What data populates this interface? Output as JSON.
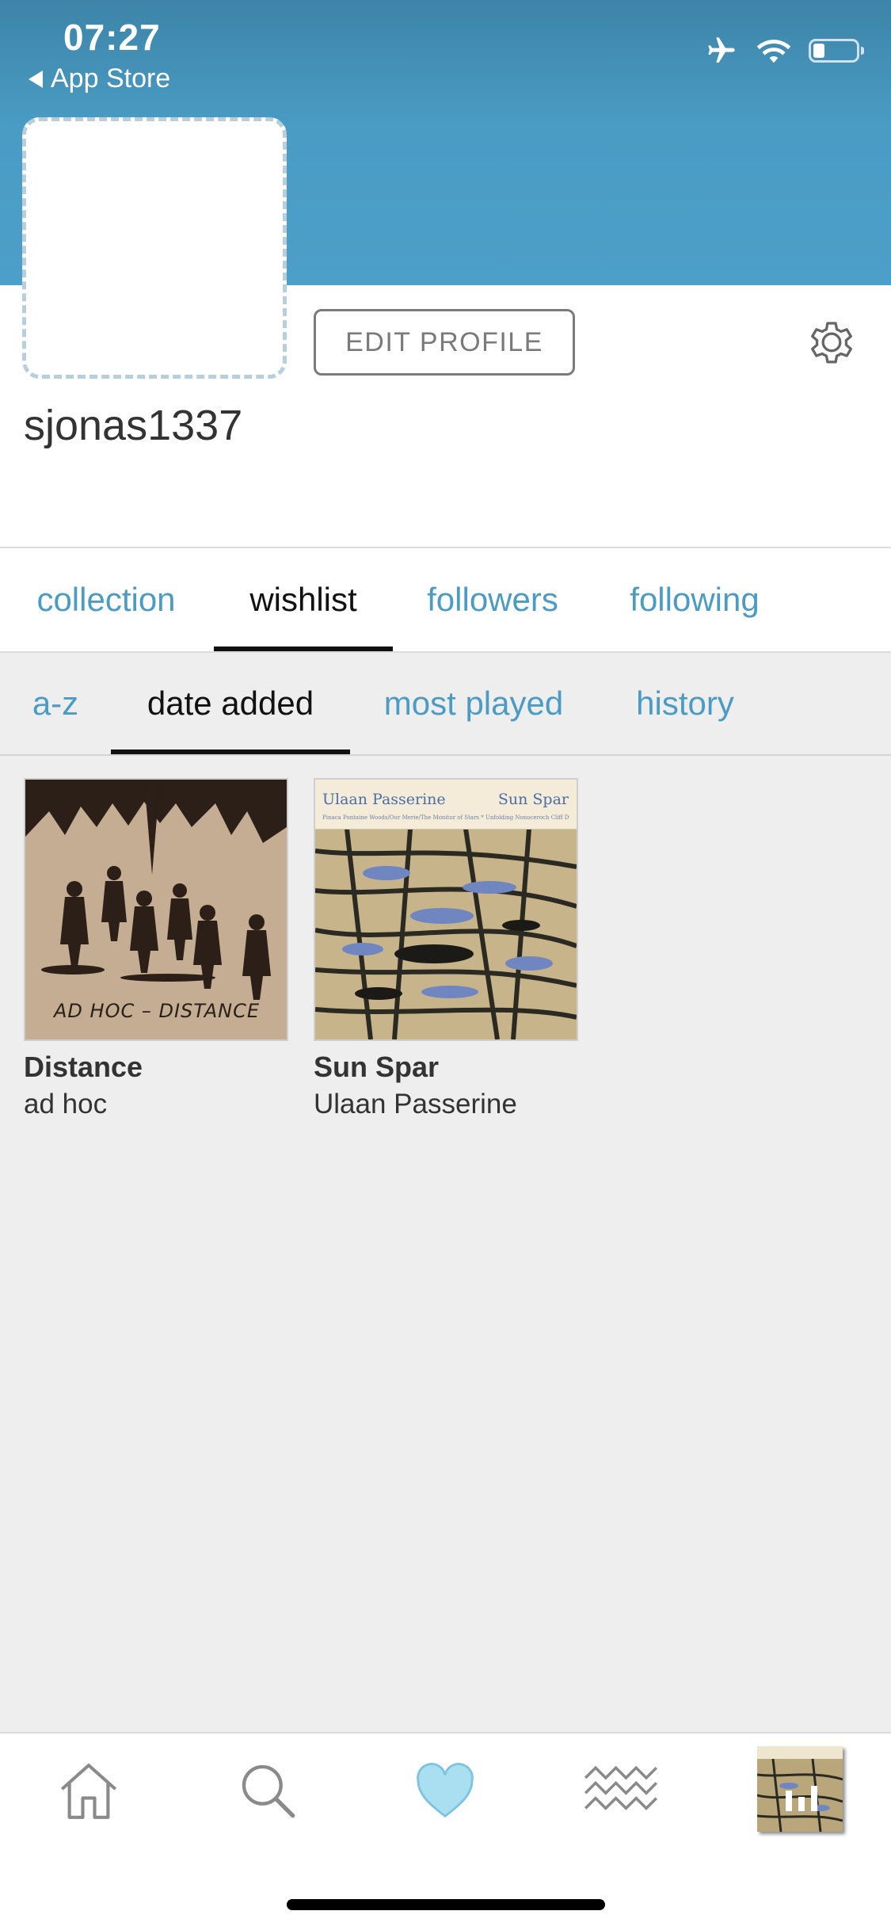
{
  "status_bar": {
    "time": "07:27",
    "back_label": "App Store",
    "icons": [
      "airplane-icon",
      "wifi-icon",
      "battery-icon"
    ]
  },
  "profile": {
    "username": "sjonas1337",
    "edit_button_label": "EDIT PROFILE",
    "settings_icon": "gear-icon"
  },
  "tabs": [
    {
      "label": "collection",
      "active": false
    },
    {
      "label": "wishlist",
      "active": true
    },
    {
      "label": "followers",
      "active": false
    },
    {
      "label": "following",
      "active": false
    }
  ],
  "sort_tabs": [
    {
      "label": "a-z",
      "active": false
    },
    {
      "label": "date added",
      "active": true
    },
    {
      "label": "most played",
      "active": false
    },
    {
      "label": "history",
      "active": false
    }
  ],
  "albums": [
    {
      "title": "Distance",
      "artist": "ad hoc",
      "cover_text": "AD HOC  –  DISTANCE"
    },
    {
      "title": "Sun Spar",
      "artist": "Ulaan Passerine",
      "cover_artist": "Ulaan Passerine",
      "cover_title": "Sun Spar",
      "cover_subtitle": "Pinaca Pontaine Woods/Our Merie/The Monitor of Stars * Unfolding Nonoceroch Cliff Dwelling Mouse"
    }
  ],
  "bottom_nav": [
    "home-icon",
    "search-icon",
    "heart-icon",
    "feed-icon",
    "now-playing-thumbnail"
  ],
  "colors": {
    "accent": "#4a9cc5",
    "header": "#4a9cc5",
    "heart": "#a9dff0"
  }
}
